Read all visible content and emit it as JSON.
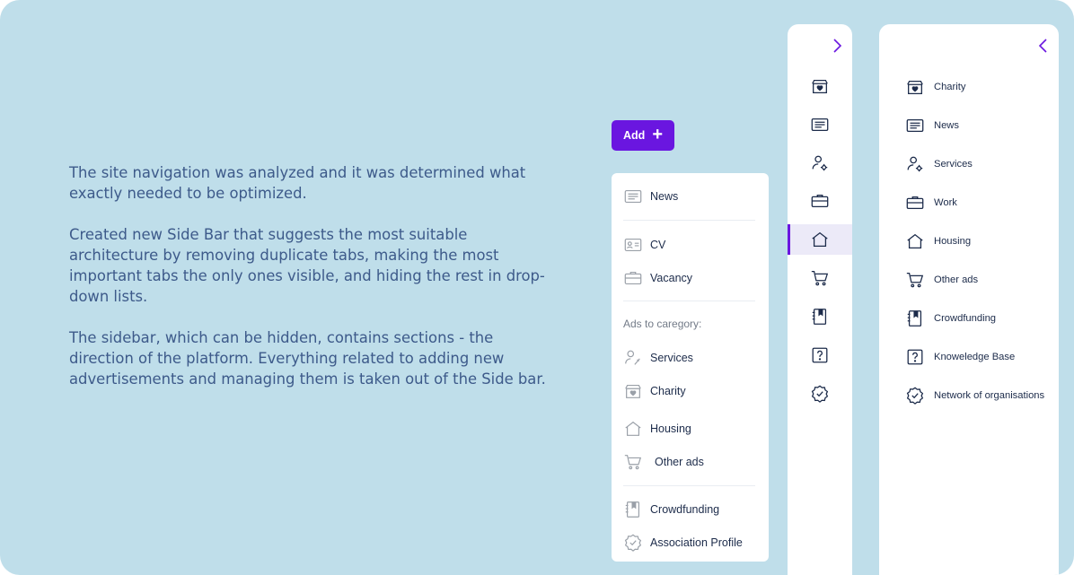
{
  "description": {
    "paragraphs": [
      "The site navigation was analyzed and it was determined what exactly needed to be optimized.",
      "Created new Side Bar that suggests the most suitable architecture by removing duplicate tabs, making the most important tabs the only ones visible, and hiding the rest in drop-down lists.",
      "The sidebar, which can be hidden, contains sections - the direction of the platform. Everything related to adding new advertisements and managing them is taken out of the Side bar."
    ]
  },
  "add_button": {
    "label": "Add",
    "plus": "+"
  },
  "dropdown": {
    "news": "News",
    "cv": "CV",
    "vacancy": "Vacancy",
    "caption": "Ads to caregory:",
    "services": "Services",
    "charity": "Charity",
    "housing": "Housing",
    "other_ads": "Other ads",
    "crowdfunding": "Crowdfunding",
    "association_profile": "Association Profile"
  },
  "sidebar": {
    "items": [
      {
        "label": "Charity",
        "icon": "charity-box-icon"
      },
      {
        "label": "News",
        "icon": "news-icon"
      },
      {
        "label": "Services",
        "icon": "services-icon"
      },
      {
        "label": "Work",
        "icon": "briefcase-icon"
      },
      {
        "label": "Housing",
        "icon": "home-icon"
      },
      {
        "label": "Other ads",
        "icon": "cart-icon"
      },
      {
        "label": "Crowdfunding",
        "icon": "notebook-icon"
      },
      {
        "label": "Knoweledge Base",
        "icon": "question-icon"
      },
      {
        "label": "Network of organisations",
        "icon": "badge-check-icon"
      }
    ],
    "active_item": "Housing"
  },
  "colors": {
    "accent": "#6a16e0",
    "background": "#bfdeea",
    "text": "#3d5a8a"
  }
}
